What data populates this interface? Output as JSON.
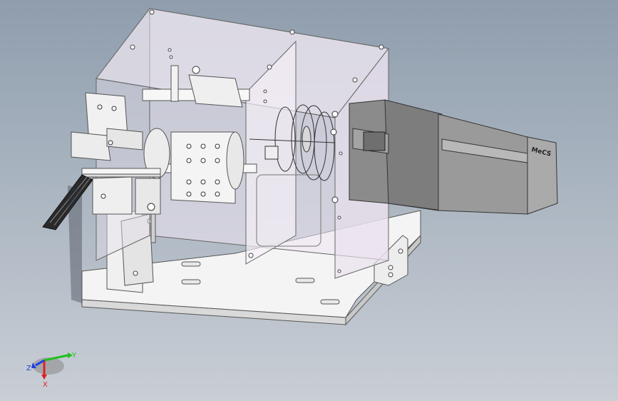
{
  "viewport": {
    "background_top": "#8f9dad",
    "background_bottom": "#c9ced5"
  },
  "model": {
    "motor_brand": "MeCS"
  },
  "triad": {
    "x_label": "X",
    "y_label": "Y",
    "z_label": "Z",
    "x_color": "#e02020",
    "y_color": "#20c020",
    "z_color": "#2040e0"
  }
}
